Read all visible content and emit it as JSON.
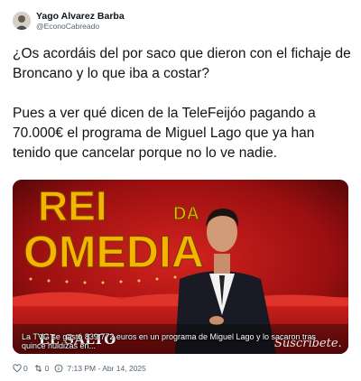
{
  "author": {
    "name": "Yago Alvarez Barba",
    "handle": "@EconoCabreado"
  },
  "tweet": {
    "paragraphs": [
      "¿Os acordáis del por saco que dieron con el fichaje de Broncano y lo que iba a costar?",
      "Pues a ver qué dicen de la TeleFeijóo pagando a 70.000€ el programa de Miguel Lago que ya han tenido que cancelar porque no lo ve nadie."
    ]
  },
  "media": {
    "sign_letters": [
      "REI",
      "DA",
      "OMEDIA"
    ],
    "logo": "EL SALTO",
    "cta": "Suscríbete.",
    "caption": "La TVG se gastó 839.772 euros en un programa de Miguel Lago y lo sacaron tras quince huidizas en..."
  },
  "stats": {
    "likes": "0",
    "retweets": "0",
    "timestamp": "7:13 PM - Abr 14, 2025"
  },
  "colors": {
    "text": "#0f1419",
    "secondary": "#536471",
    "stage_red": "#c4141b",
    "sign_yellow": "#f5b400"
  }
}
